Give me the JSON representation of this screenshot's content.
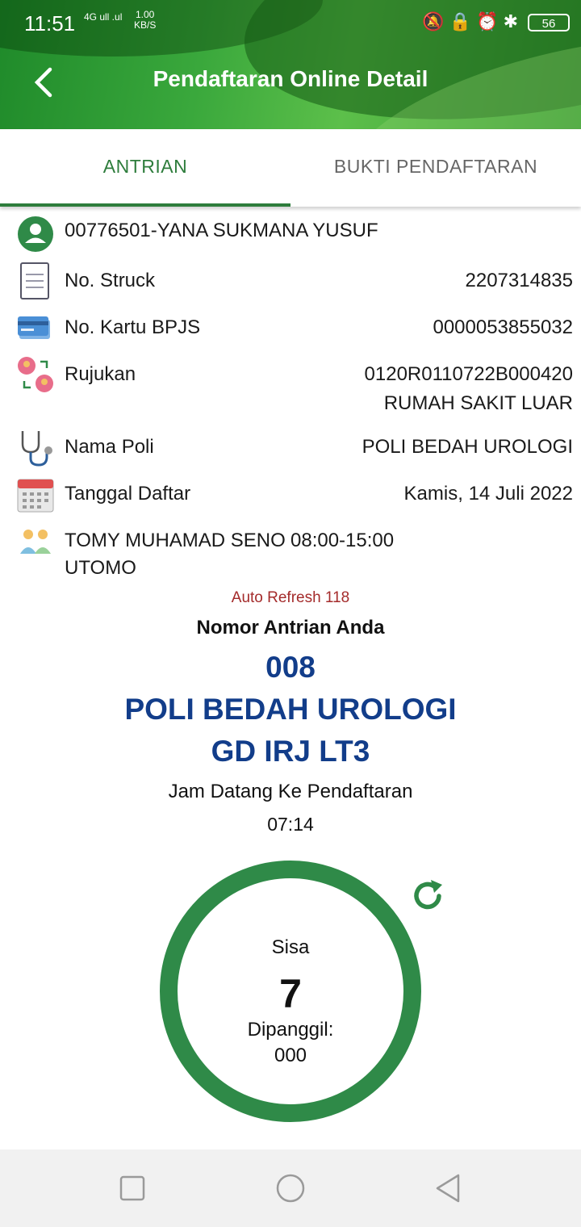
{
  "status_bar": {
    "time": "11:51",
    "signal": "4G ull .ul",
    "speed_value": "1.00",
    "speed_unit": "KB/S",
    "icons": [
      "bell-off-icon",
      "lock-icon",
      "alarm-icon",
      "bluetooth-icon"
    ],
    "battery": "56"
  },
  "header": {
    "title": "Pendaftaran Online Detail",
    "color": "#3aa83c"
  },
  "tabs": [
    {
      "label": "ANTRIAN",
      "active": true
    },
    {
      "label": "BUKTI PENDAFTARAN",
      "active": false
    }
  ],
  "details": {
    "patient": "00776501-YANA SUKMANA YUSUF",
    "struck_label": "No. Struck",
    "struck_value": "2207314835",
    "bpjs_label": "No. Kartu BPJS",
    "bpjs_value": "0000053855032",
    "rujukan_label": "Rujukan",
    "rujukan_value": "0120R0110722B000420",
    "rujukan_value2": "RUMAH SAKIT LUAR",
    "poli_label": "Nama Poli",
    "poli_value": "POLI BEDAH UROLOGI",
    "tanggal_label": "Tanggal Daftar",
    "tanggal_value": "Kamis, 14 Juli 2022",
    "doctor_line1": "TOMY MUHAMAD SENO",
    "doctor_line2": "UTOMO",
    "doctor_time": "08:00-15:00"
  },
  "queue": {
    "auto_refresh": "Auto Refresh 118",
    "nomor_label": "Nomor Antrian Anda",
    "nomor": "008",
    "poli": "POLI BEDAH UROLOGI",
    "gedung": "GD IRJ LT3",
    "jam_label": "Jam Datang Ke Pendaftaran",
    "jam_value": "07:14",
    "sisa_label": "Sisa",
    "sisa_value": "7",
    "dipanggil_label": "Dipanggil:",
    "dipanggil_value": "000",
    "accent": "#2f8a48",
    "number_color": "#123d8a"
  }
}
